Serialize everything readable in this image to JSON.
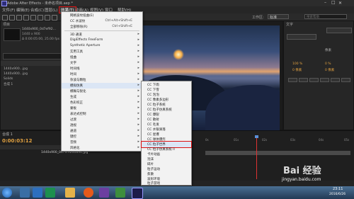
{
  "titlebar": {
    "title": "Adobe After Effects - 未命名项目.aep *"
  },
  "menubar": {
    "items": [
      "文件(F)",
      "编辑(E)",
      "合成(C)",
      "图层(L)",
      "效果(T)",
      "动画(A)",
      "视图(V)",
      "窗口",
      "帮助(H)"
    ],
    "active_index": 4,
    "workspace_label": "工作区:",
    "workspace_value": "标准",
    "search_placeholder": "搜索帮助"
  },
  "effect_menu": {
    "items": [
      {
        "label": "网格波纹扭曲(E)",
        "shortcut": "",
        "arrow": false
      },
      {
        "label": "CC 水波纹",
        "shortcut": "Ctrl+Alt+Shift+E",
        "arrow": false
      },
      {
        "label": "全部移除(R)",
        "shortcut": "Ctrl+Shift+E",
        "arrow": false
      },
      {
        "label": "3D 通道",
        "shortcut": "",
        "arrow": true
      },
      {
        "label": "DigiEffects FreeForm",
        "shortcut": "",
        "arrow": true
      },
      {
        "label": "Synthetic Aperture",
        "shortcut": "",
        "arrow": true
      },
      {
        "label": "实用工具",
        "shortcut": "",
        "arrow": true
      },
      {
        "label": "扭曲",
        "shortcut": "",
        "arrow": true
      },
      {
        "label": "文字",
        "shortcut": "",
        "arrow": true
      },
      {
        "label": "时间线",
        "shortcut": "",
        "arrow": true
      },
      {
        "label": "时间",
        "shortcut": "",
        "arrow": true
      },
      {
        "label": "杂波与颗粒",
        "shortcut": "",
        "arrow": true
      },
      {
        "label": "模拟仿真",
        "shortcut": "",
        "arrow": true
      },
      {
        "label": "模糊与锐化",
        "shortcut": "",
        "arrow": true
      },
      {
        "label": "生成",
        "shortcut": "",
        "arrow": true
      },
      {
        "label": "色彩校正",
        "shortcut": "",
        "arrow": true
      },
      {
        "label": "蒙板",
        "shortcut": "",
        "arrow": true
      },
      {
        "label": "表达式控制",
        "shortcut": "",
        "arrow": true
      },
      {
        "label": "过渡",
        "shortcut": "",
        "arrow": true
      },
      {
        "label": "透视",
        "shortcut": "",
        "arrow": true
      },
      {
        "label": "通道",
        "shortcut": "",
        "arrow": true
      },
      {
        "label": "键控",
        "shortcut": "",
        "arrow": true
      },
      {
        "label": "音频",
        "shortcut": "",
        "arrow": true
      },
      {
        "label": "风格化",
        "shortcut": "",
        "arrow": true
      }
    ],
    "highlighted_index": 12
  },
  "submenu": {
    "items": [
      "CC 下雨",
      "CC 下雪",
      "CC 泡泡",
      "CC 像素多边形",
      "CC 粒子系统",
      "CC 粒子仿真系统",
      "CC 爆裂",
      "CC 散射",
      "CC 毛发",
      "CC 水银滴落",
      "CC 星爆",
      "CC 球体爆炸",
      "CC 粒子世界",
      "CC 粒子仿真系统 II",
      "卡片动画",
      "泡沫",
      "碎片",
      "粒子运动",
      "焦散",
      "波形环境",
      "粒子游戏"
    ],
    "highlighted_index": 12
  },
  "project_panel": {
    "title": "项目",
    "comp_name": "1440x900_0d7ef92...",
    "comp_info": "1440 x 900",
    "comp_fps": "Δ 0:00:05:00, 25.00 fps",
    "rows": [
      "1440x900...jpg",
      "1440x900...jpg",
      "Solids",
      "合成 1"
    ]
  },
  "timeline": {
    "tab_label": "合成 1",
    "timecode": "0:00:03:12",
    "layer_name": "1440x900_0d7ef92d0894.jpg",
    "ruler_marks": [
      "0s",
      "01s",
      "02s",
      "03s",
      "04s",
      "05s"
    ]
  },
  "right_panel": {
    "title": "文字",
    "rows": [
      "像素",
      "100 %",
      "0 %",
      "0 像素",
      "0 像素"
    ]
  },
  "taskbar": {
    "time": "23:11",
    "date": "2016/6/26"
  },
  "watermark": {
    "brand": "Bai 经验",
    "url": "jingyan.baidu.com"
  },
  "colors": {
    "menu_bg": "#f2f2f2",
    "highlight": "#dbe6f5",
    "accent": "#d11",
    "panel_bg": "#262626"
  }
}
